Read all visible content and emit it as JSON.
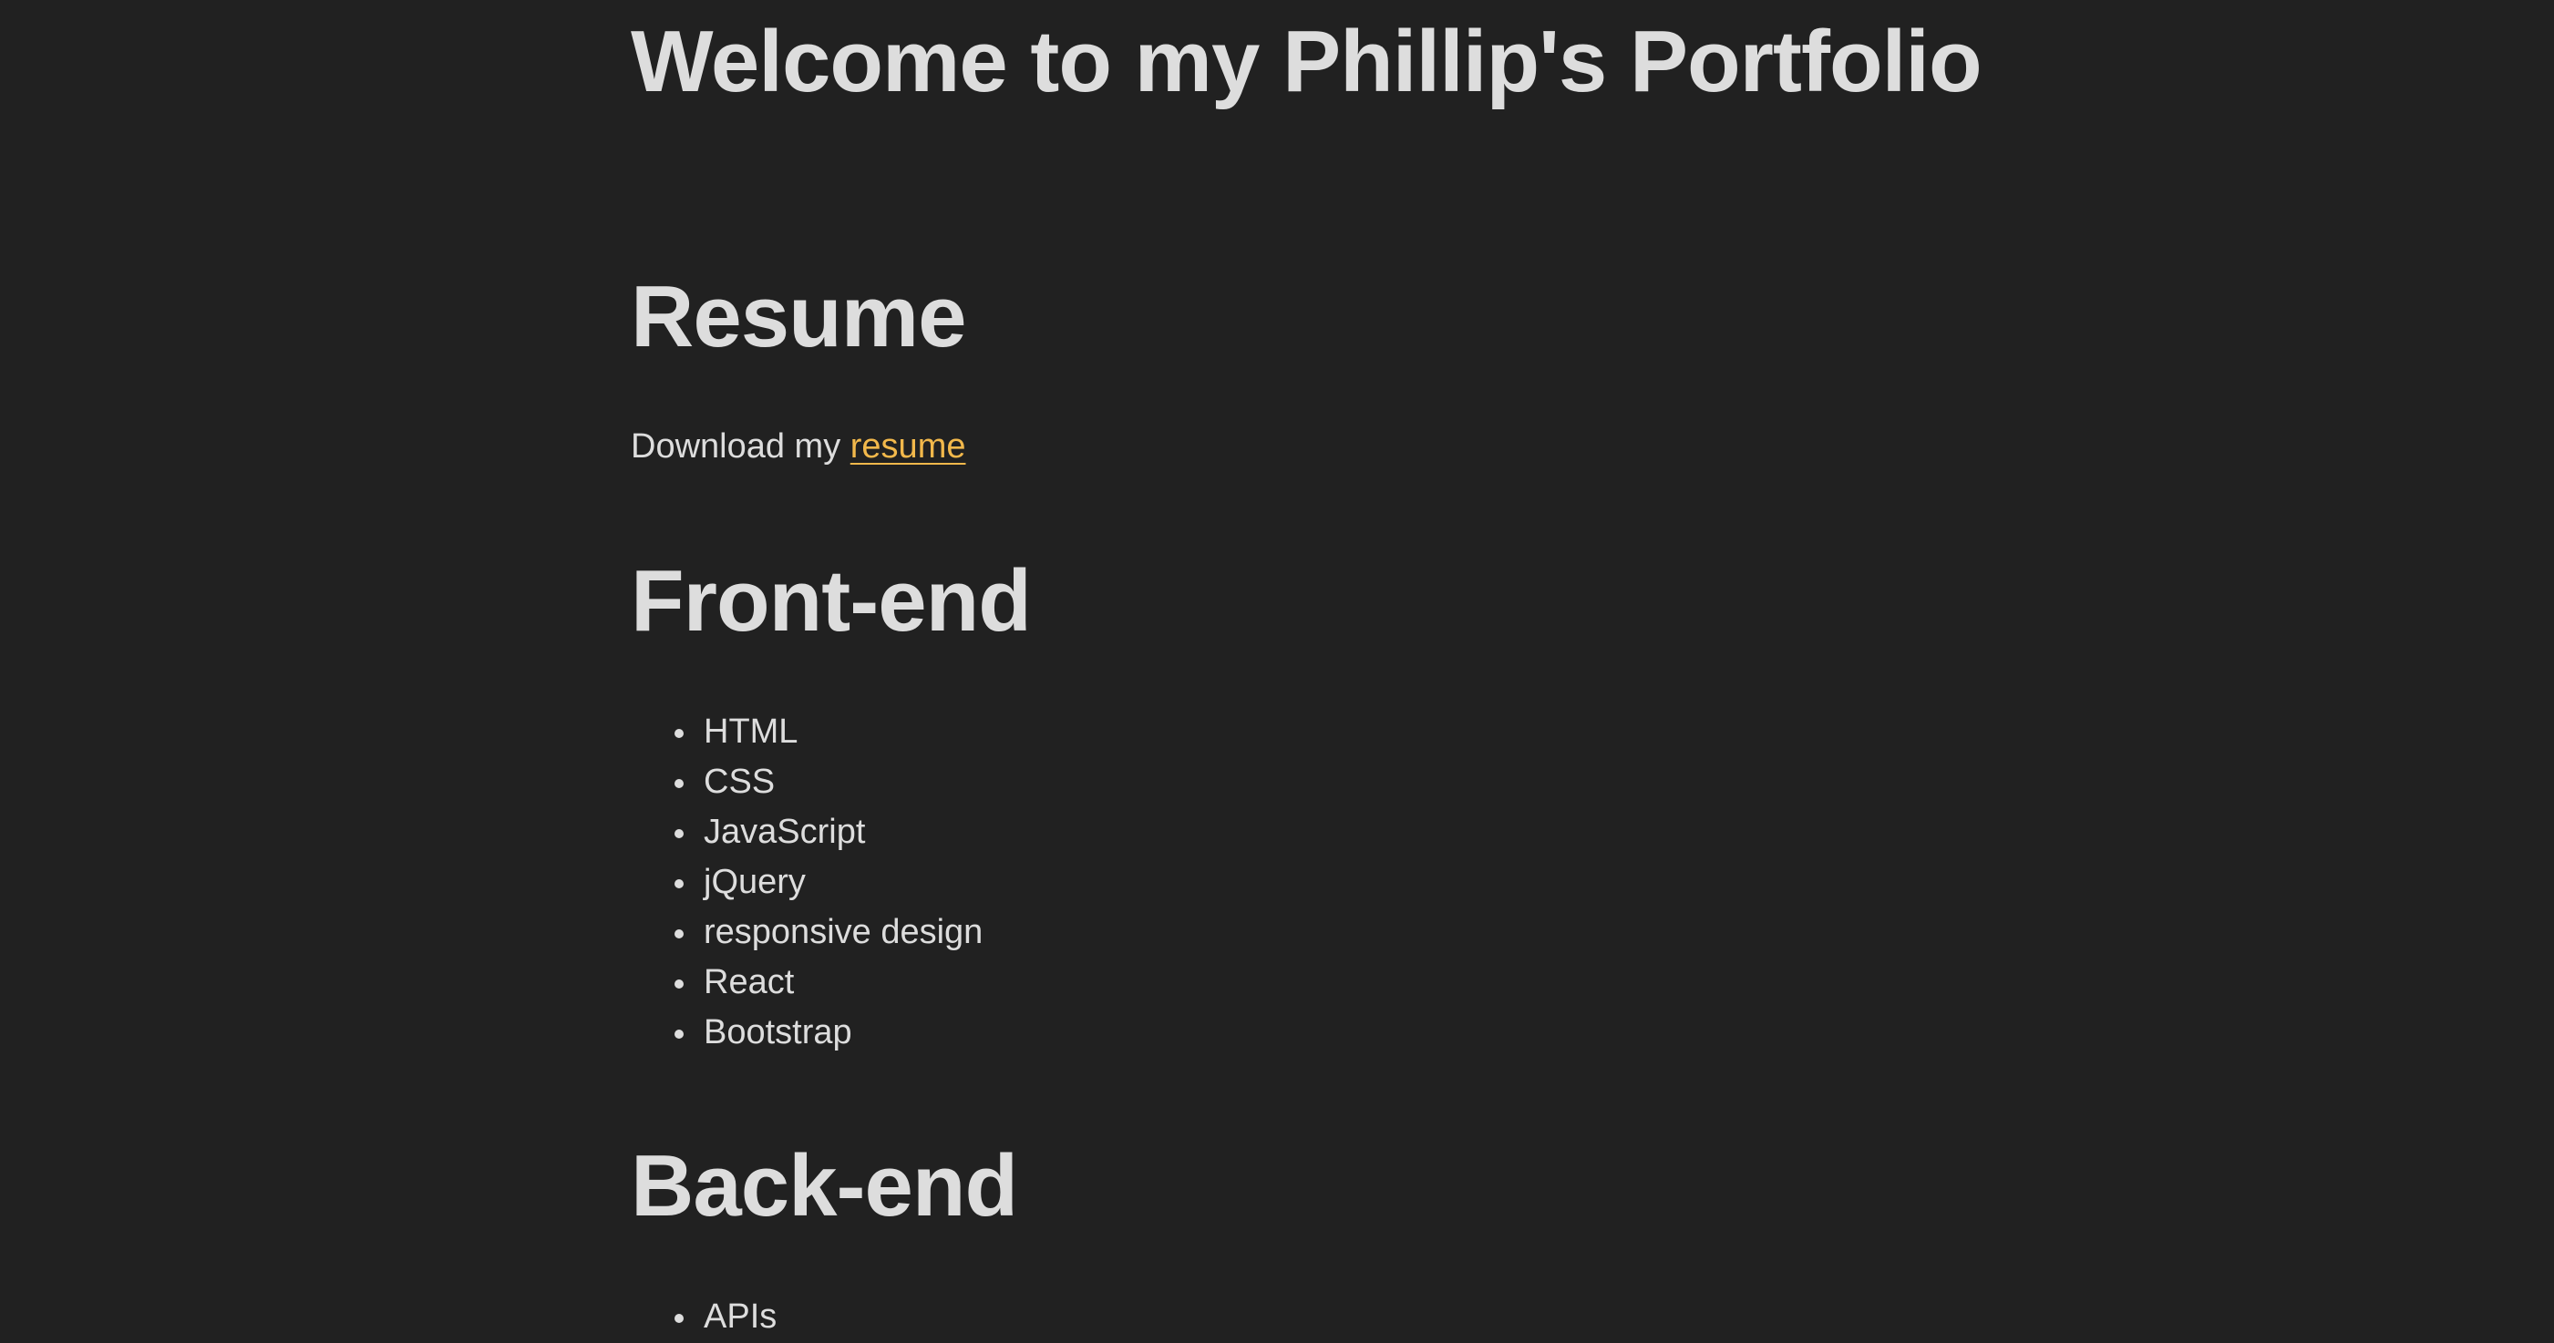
{
  "page": {
    "title": "Welcome to my Phillip's Portfolio"
  },
  "resume": {
    "heading": "Resume",
    "text": "Download my ",
    "link_label": "resume"
  },
  "frontend": {
    "heading": "Front-end",
    "items": [
      "HTML",
      "CSS",
      "JavaScript",
      "jQuery",
      "responsive design",
      "React",
      "Bootstrap"
    ]
  },
  "backend": {
    "heading": "Back-end",
    "items": [
      "APIs"
    ]
  },
  "colors": {
    "background": "#212121",
    "text": "#dddddd",
    "link": "#f2b84b"
  }
}
